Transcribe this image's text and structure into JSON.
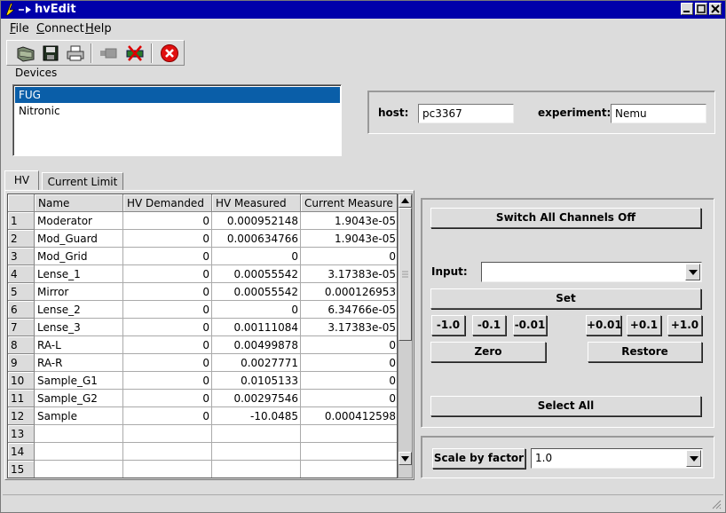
{
  "window": {
    "title": "hvEdit"
  },
  "menu": {
    "file": "File",
    "connect": "Connect",
    "help": "Help"
  },
  "toolbar": {
    "icons": [
      "open-icon",
      "save-icon",
      "print-icon",
      "connect-icon",
      "disconnect-icon",
      "quit-icon"
    ]
  },
  "devices": {
    "label": "Devices",
    "items": [
      "FUG",
      "Nitronic"
    ],
    "selected": "FUG"
  },
  "connection": {
    "host_label": "host:",
    "host_value": "pc3367",
    "experiment_label": "experiment:",
    "experiment_value": "Nemu"
  },
  "tabs": {
    "hv": "HV",
    "current_limit": "Current Limit"
  },
  "table": {
    "headers": [
      "Name",
      "HV Demanded",
      "HV Measured",
      "Current Measure"
    ],
    "rows": [
      {
        "n": "1",
        "name": "Moderator",
        "dem": "0",
        "meas": "0.000952148",
        "cur": "1.9043e-05"
      },
      {
        "n": "2",
        "name": "Mod_Guard",
        "dem": "0",
        "meas": "0.000634766",
        "cur": "1.9043e-05"
      },
      {
        "n": "3",
        "name": "Mod_Grid",
        "dem": "0",
        "meas": "0",
        "cur": "0"
      },
      {
        "n": "4",
        "name": "Lense_1",
        "dem": "0",
        "meas": "0.00055542",
        "cur": "3.17383e-05"
      },
      {
        "n": "5",
        "name": "Mirror",
        "dem": "0",
        "meas": "0.00055542",
        "cur": "0.000126953"
      },
      {
        "n": "6",
        "name": "Lense_2",
        "dem": "0",
        "meas": "0",
        "cur": "6.34766e-05"
      },
      {
        "n": "7",
        "name": "Lense_3",
        "dem": "0",
        "meas": "0.00111084",
        "cur": "3.17383e-05"
      },
      {
        "n": "8",
        "name": "RA-L",
        "dem": "0",
        "meas": "0.00499878",
        "cur": "0"
      },
      {
        "n": "9",
        "name": "RA-R",
        "dem": "0",
        "meas": "0.0027771",
        "cur": "0"
      },
      {
        "n": "10",
        "name": "Sample_G1",
        "dem": "0",
        "meas": "0.0105133",
        "cur": "0"
      },
      {
        "n": "11",
        "name": "Sample_G2",
        "dem": "0",
        "meas": "0.00297546",
        "cur": "0"
      },
      {
        "n": "12",
        "name": "Sample",
        "dem": "0",
        "meas": "-10.0485",
        "cur": "0.000412598"
      },
      {
        "n": "13",
        "name": "",
        "dem": "",
        "meas": "",
        "cur": ""
      },
      {
        "n": "14",
        "name": "",
        "dem": "",
        "meas": "",
        "cur": ""
      },
      {
        "n": "15",
        "name": "",
        "dem": "",
        "meas": "",
        "cur": ""
      }
    ]
  },
  "controls": {
    "switch_off": "Switch All Channels Off",
    "input_label": "Input:",
    "input_value": "",
    "set": "Set",
    "minus_1": "-1.0",
    "minus_01": "-0.1",
    "minus_001": "-0.01",
    "plus_001": "+0.01",
    "plus_01": "+0.1",
    "plus_1": "+1.0",
    "zero": "Zero",
    "restore": "Restore",
    "select_all": "Select All",
    "scale_button": "Scale by factor",
    "scale_value": "1.0"
  },
  "colors": {
    "title_bar": "#0000aa",
    "selection": "#0a5ea8",
    "quit_icon": "#e01010"
  }
}
